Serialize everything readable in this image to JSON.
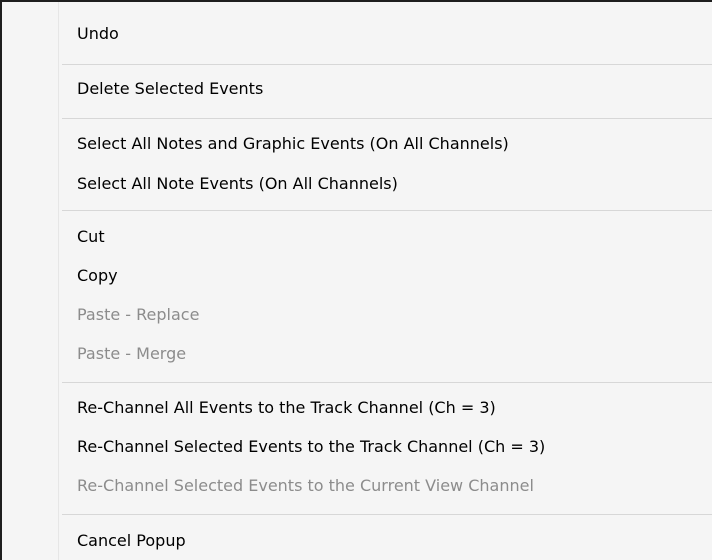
{
  "menu": {
    "items": [
      {
        "label": "Undo",
        "enabled": true
      },
      {
        "label": "Delete Selected Events",
        "enabled": true
      },
      {
        "label": "Select All Notes and Graphic Events (On All Channels)",
        "enabled": true
      },
      {
        "label": "Select All Note Events (On All Channels)",
        "enabled": true
      },
      {
        "label": "Cut",
        "enabled": true
      },
      {
        "label": "Copy",
        "enabled": true
      },
      {
        "label": "Paste - Replace",
        "enabled": false
      },
      {
        "label": "Paste - Merge",
        "enabled": false
      },
      {
        "label": "Re-Channel All Events to the Track Channel (Ch = 3)",
        "enabled": true
      },
      {
        "label": "Re-Channel Selected Events to the Track Channel (Ch = 3)",
        "enabled": true
      },
      {
        "label": "Re-Channel Selected Events to the Current View Channel",
        "enabled": false
      },
      {
        "label": "Cancel Popup",
        "enabled": true
      }
    ]
  }
}
